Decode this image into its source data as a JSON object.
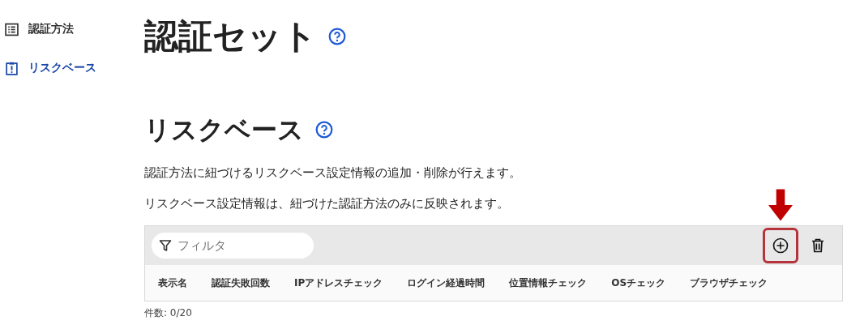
{
  "sidebar": {
    "items": [
      {
        "kind": "list",
        "label": "認証方法",
        "selected": false
      },
      {
        "kind": "alert",
        "label": "リスクベース",
        "selected": true
      }
    ]
  },
  "page_title": "認証セット",
  "section": {
    "title": "リスクベース",
    "description": [
      "認証方法に紐づけるリスクベース設定情報の追加・削除が行えます。",
      "リスクベース設定情報は、紐づけた認証方法のみに反映されます。"
    ]
  },
  "table": {
    "filter": {
      "placeholder": "フィルタ"
    },
    "actions": [
      {
        "kind": "add",
        "highlighted": true
      },
      {
        "kind": "delete",
        "highlighted": false
      }
    ],
    "columns": [
      "表示名",
      "認証失敗回数",
      "IPアドレスチェック",
      "ログイン経過時間",
      "位置情報チェック",
      "OSチェック",
      "ブラウザチェック"
    ]
  },
  "count": "件数: 0/20"
}
